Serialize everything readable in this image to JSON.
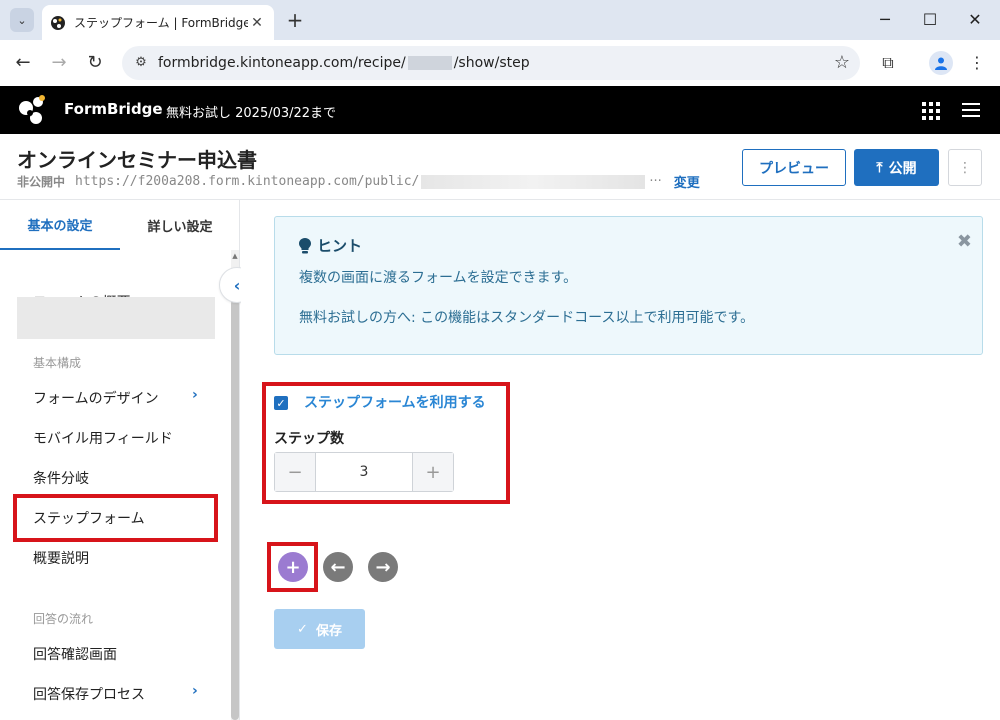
{
  "browser": {
    "tab_title": "ステップフォーム | FormBridge",
    "tab_close": "✕",
    "new_tab": "+",
    "url_prefix": "formbridge.kintoneapp.com/recipe/",
    "url_suffix": "/show/step"
  },
  "app": {
    "brand": "FormBridge",
    "trial_notice": "無料お試し 2025/03/22まで"
  },
  "form": {
    "title": "オンラインセミナー申込書",
    "status": "非公開中",
    "public_url": "https://f200a208.form.kintoneapp.com/public/",
    "url_ellipsis": "···",
    "change_label": "変更",
    "preview_label": "プレビュー",
    "publish_label": "公開",
    "more_label": "⋮"
  },
  "sidebar": {
    "tabs": [
      {
        "label": "基本の設定",
        "active": true
      },
      {
        "label": "詳しい設定",
        "active": false
      }
    ],
    "items": [
      {
        "label": "フォームの概要"
      },
      {
        "section": "基本構成"
      },
      {
        "label": "フォームのデザイン",
        "has_submenu": true
      },
      {
        "label": "モバイル用フィールド"
      },
      {
        "label": "条件分岐"
      },
      {
        "label": "ステップフォーム",
        "selected": true
      },
      {
        "label": "概要説明"
      },
      {
        "section": "回答の流れ"
      },
      {
        "label": "回答確認画面"
      },
      {
        "label": "回答保存プロセス",
        "has_submenu": true
      }
    ]
  },
  "hint": {
    "title": "ヒント",
    "line1": "複数の画面に渡るフォームを設定できます。",
    "line2": "無料お試しの方へ: この機能はスタンダードコース以上で利用可能です。",
    "close": "✖"
  },
  "step_form": {
    "enable_label": "ステップフォームを利用する",
    "enabled": true,
    "count_label": "ステップ数",
    "count_value": "3",
    "decrement": "−",
    "increment": "+"
  },
  "actions": {
    "add_icon": "plus-circle-icon",
    "prev_icon": "arrow-left-circle-icon",
    "next_icon": "arrow-right-circle-icon",
    "save_label": "保存"
  },
  "colors": {
    "accent": "#1f6fbf",
    "highlight_red": "#d7141a",
    "add_purple": "#9b7bd1",
    "nav_gray": "#7a7a7a",
    "save_disabled": "#a8cff0"
  }
}
